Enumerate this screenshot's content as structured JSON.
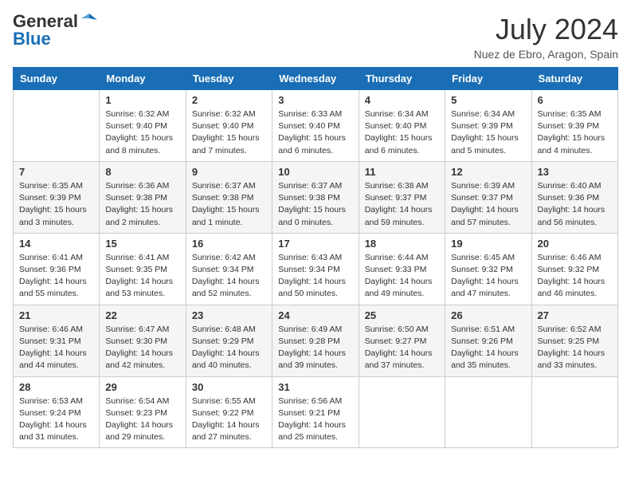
{
  "logo": {
    "general": "General",
    "blue": "Blue"
  },
  "title": {
    "month_year": "July 2024",
    "location": "Nuez de Ebro, Aragon, Spain"
  },
  "calendar": {
    "headers": [
      "Sunday",
      "Monday",
      "Tuesday",
      "Wednesday",
      "Thursday",
      "Friday",
      "Saturday"
    ],
    "rows": [
      [
        {
          "day": "",
          "info": ""
        },
        {
          "day": "1",
          "info": "Sunrise: 6:32 AM\nSunset: 9:40 PM\nDaylight: 15 hours\nand 8 minutes."
        },
        {
          "day": "2",
          "info": "Sunrise: 6:32 AM\nSunset: 9:40 PM\nDaylight: 15 hours\nand 7 minutes."
        },
        {
          "day": "3",
          "info": "Sunrise: 6:33 AM\nSunset: 9:40 PM\nDaylight: 15 hours\nand 6 minutes."
        },
        {
          "day": "4",
          "info": "Sunrise: 6:34 AM\nSunset: 9:40 PM\nDaylight: 15 hours\nand 6 minutes."
        },
        {
          "day": "5",
          "info": "Sunrise: 6:34 AM\nSunset: 9:39 PM\nDaylight: 15 hours\nand 5 minutes."
        },
        {
          "day": "6",
          "info": "Sunrise: 6:35 AM\nSunset: 9:39 PM\nDaylight: 15 hours\nand 4 minutes."
        }
      ],
      [
        {
          "day": "7",
          "info": "Sunrise: 6:35 AM\nSunset: 9:39 PM\nDaylight: 15 hours\nand 3 minutes."
        },
        {
          "day": "8",
          "info": "Sunrise: 6:36 AM\nSunset: 9:38 PM\nDaylight: 15 hours\nand 2 minutes."
        },
        {
          "day": "9",
          "info": "Sunrise: 6:37 AM\nSunset: 9:38 PM\nDaylight: 15 hours\nand 1 minute."
        },
        {
          "day": "10",
          "info": "Sunrise: 6:37 AM\nSunset: 9:38 PM\nDaylight: 15 hours\nand 0 minutes."
        },
        {
          "day": "11",
          "info": "Sunrise: 6:38 AM\nSunset: 9:37 PM\nDaylight: 14 hours\nand 59 minutes."
        },
        {
          "day": "12",
          "info": "Sunrise: 6:39 AM\nSunset: 9:37 PM\nDaylight: 14 hours\nand 57 minutes."
        },
        {
          "day": "13",
          "info": "Sunrise: 6:40 AM\nSunset: 9:36 PM\nDaylight: 14 hours\nand 56 minutes."
        }
      ],
      [
        {
          "day": "14",
          "info": "Sunrise: 6:41 AM\nSunset: 9:36 PM\nDaylight: 14 hours\nand 55 minutes."
        },
        {
          "day": "15",
          "info": "Sunrise: 6:41 AM\nSunset: 9:35 PM\nDaylight: 14 hours\nand 53 minutes."
        },
        {
          "day": "16",
          "info": "Sunrise: 6:42 AM\nSunset: 9:34 PM\nDaylight: 14 hours\nand 52 minutes."
        },
        {
          "day": "17",
          "info": "Sunrise: 6:43 AM\nSunset: 9:34 PM\nDaylight: 14 hours\nand 50 minutes."
        },
        {
          "day": "18",
          "info": "Sunrise: 6:44 AM\nSunset: 9:33 PM\nDaylight: 14 hours\nand 49 minutes."
        },
        {
          "day": "19",
          "info": "Sunrise: 6:45 AM\nSunset: 9:32 PM\nDaylight: 14 hours\nand 47 minutes."
        },
        {
          "day": "20",
          "info": "Sunrise: 6:46 AM\nSunset: 9:32 PM\nDaylight: 14 hours\nand 46 minutes."
        }
      ],
      [
        {
          "day": "21",
          "info": "Sunrise: 6:46 AM\nSunset: 9:31 PM\nDaylight: 14 hours\nand 44 minutes."
        },
        {
          "day": "22",
          "info": "Sunrise: 6:47 AM\nSunset: 9:30 PM\nDaylight: 14 hours\nand 42 minutes."
        },
        {
          "day": "23",
          "info": "Sunrise: 6:48 AM\nSunset: 9:29 PM\nDaylight: 14 hours\nand 40 minutes."
        },
        {
          "day": "24",
          "info": "Sunrise: 6:49 AM\nSunset: 9:28 PM\nDaylight: 14 hours\nand 39 minutes."
        },
        {
          "day": "25",
          "info": "Sunrise: 6:50 AM\nSunset: 9:27 PM\nDaylight: 14 hours\nand 37 minutes."
        },
        {
          "day": "26",
          "info": "Sunrise: 6:51 AM\nSunset: 9:26 PM\nDaylight: 14 hours\nand 35 minutes."
        },
        {
          "day": "27",
          "info": "Sunrise: 6:52 AM\nSunset: 9:25 PM\nDaylight: 14 hours\nand 33 minutes."
        }
      ],
      [
        {
          "day": "28",
          "info": "Sunrise: 6:53 AM\nSunset: 9:24 PM\nDaylight: 14 hours\nand 31 minutes."
        },
        {
          "day": "29",
          "info": "Sunrise: 6:54 AM\nSunset: 9:23 PM\nDaylight: 14 hours\nand 29 minutes."
        },
        {
          "day": "30",
          "info": "Sunrise: 6:55 AM\nSunset: 9:22 PM\nDaylight: 14 hours\nand 27 minutes."
        },
        {
          "day": "31",
          "info": "Sunrise: 6:56 AM\nSunset: 9:21 PM\nDaylight: 14 hours\nand 25 minutes."
        },
        {
          "day": "",
          "info": ""
        },
        {
          "day": "",
          "info": ""
        },
        {
          "day": "",
          "info": ""
        }
      ]
    ]
  }
}
